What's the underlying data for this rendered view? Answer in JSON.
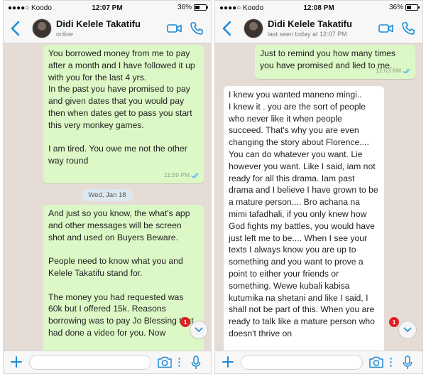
{
  "colors": {
    "accent": "#1e8bd6",
    "outgoing_bubble": "#dcf8c6",
    "incoming_bubble": "#ffffff",
    "chat_bg": "#e5ddd5",
    "badge": "#e02020"
  },
  "left": {
    "status": {
      "carrier": "●●●●○ Koodo",
      "time": "12:07 PM",
      "battery": "36%"
    },
    "header": {
      "name": "Didi Kelele Takatifu",
      "status": "online"
    },
    "messages": [
      {
        "type": "out",
        "text": "You borrowed money from me to pay after a month and I have followed it up with you for the last 4 yrs.\nIn the past you have promised to pay and given dates that you would pay then when dates get to pass you start this very monkey games.\n\nI am tired. You owe me not the other way round",
        "time": "11:59 PM"
      },
      {
        "type": "date",
        "text": "Wed, Jan 18"
      },
      {
        "type": "out",
        "text": "And just so you know, the what's app and other messages will be screen shot and used on Buyers Beware.\n\nPeople need to know what you and Kelele Takatifu stand for.\n\nThe money you had requested was 60k but I offered 15k. Reasons borrowing was to pay Jo Blessing that had done a video for you. Now",
        "time": ""
      }
    ],
    "unread_count": "1"
  },
  "right": {
    "status": {
      "carrier": "●●●●○ Koodo",
      "time": "12:08 PM",
      "battery": "36%"
    },
    "header": {
      "name": "Didi Kelele Takatifu",
      "status": "last seen today at 12:07 PM"
    },
    "messages": [
      {
        "type": "out",
        "text": "Just to remind you how many times you have promised and lied to me.",
        "time": "12:03 AM"
      },
      {
        "type": "in",
        "text": "I knew you wanted maneno mingi..\nI knew it . you are the sort of people who never like it when people succeed. That's why you are even changing the story about Florence.... You can do whatever you want. Lie however you want. Like I said, iam not ready for all this drama. Iam past drama and I believe I have grown to be a mature person.... Bro achana na mimi tafadhali, if you only knew how God fights my battles, you would have just left me to be.... When I see your texts I always know you are up to something and you want to prove a point to either your friends or something. Wewe kubali kabisa kutumika na shetani and like I said, I shall not be part of this. When you are ready to talk like a mature person who doesn't thrive on",
        "time": ""
      }
    ],
    "unread_count": "1"
  }
}
